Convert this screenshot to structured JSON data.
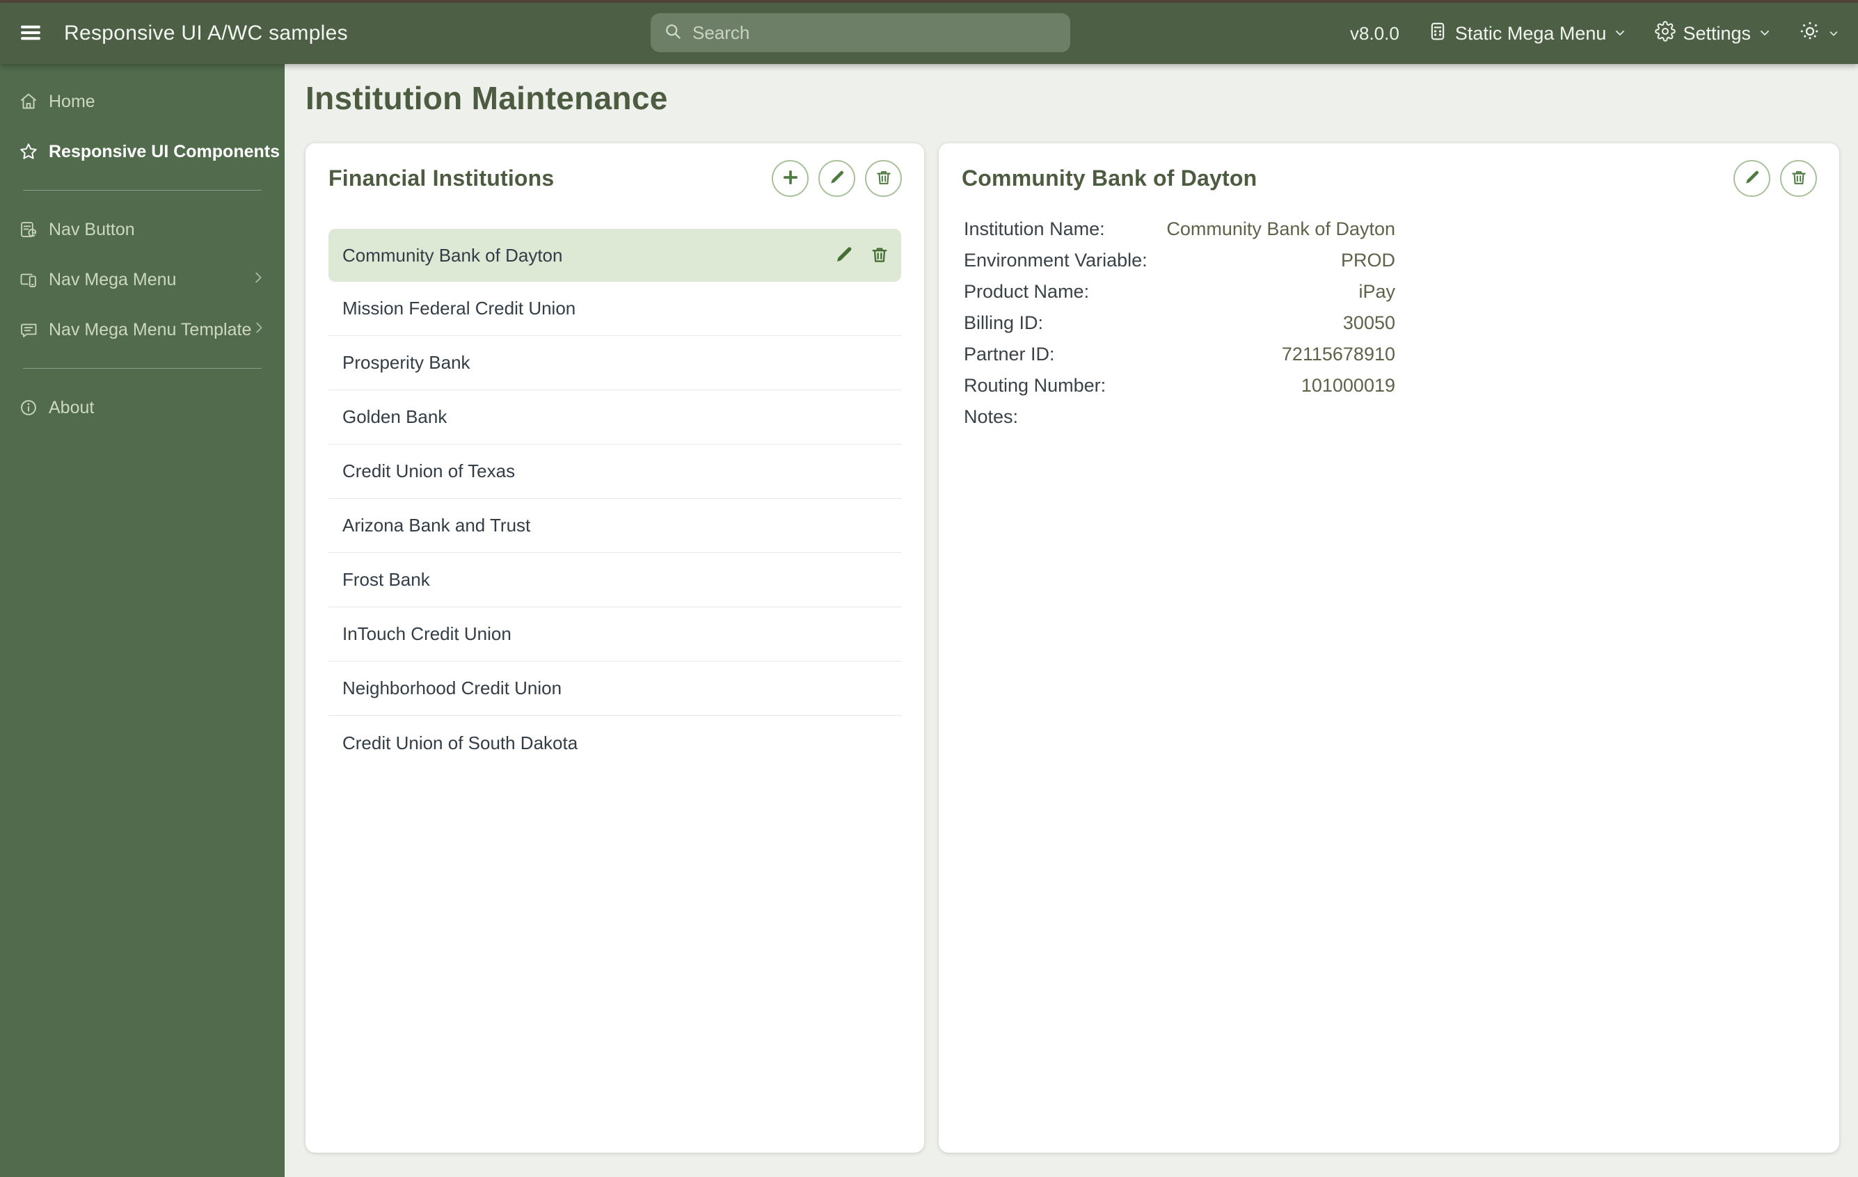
{
  "app": {
    "title": "Responsive UI A/WC samples",
    "version": "v8.0.0"
  },
  "topbar": {
    "search": {
      "placeholder": "Search"
    },
    "mega_menu": {
      "label": "Static Mega Menu"
    },
    "settings": {
      "label": "Settings"
    }
  },
  "sidebar": {
    "items": [
      {
        "label": "Home"
      },
      {
        "label": "Responsive UI Components"
      },
      {
        "label": "Nav Button"
      },
      {
        "label": "Nav Mega Menu"
      },
      {
        "label": "Nav Mega Menu Template"
      },
      {
        "label": "About"
      }
    ]
  },
  "main": {
    "page_title": "Institution Maintenance",
    "financial_institutions": {
      "title": "Financial Institutions",
      "selected_index": 0,
      "items": [
        "Community Bank of Dayton",
        "Mission Federal Credit Union",
        "Prosperity Bank",
        "Golden Bank",
        "Credit Union of Texas",
        "Arizona Bank and Trust",
        "Frost Bank",
        "InTouch Credit Union",
        "Neighborhood Credit Union",
        "Credit Union of South Dakota"
      ]
    },
    "institution_detail": {
      "title": "Community Bank of Dayton",
      "fields": [
        {
          "label": "Institution Name:",
          "value": "Community Bank of Dayton"
        },
        {
          "label": "Environment Variable:",
          "value": "PROD"
        },
        {
          "label": "Product Name:",
          "value": "iPay"
        },
        {
          "label": "Billing ID:",
          "value": "30050"
        },
        {
          "label": "Partner ID:",
          "value": "72115678910"
        },
        {
          "label": "Routing Number:",
          "value": "101000019"
        },
        {
          "label": "Notes:",
          "value": ""
        }
      ]
    }
  },
  "colors": {
    "topbar_bg": "#4d6046",
    "sidebar_bg": "#516b4c",
    "page_bg": "#eef0ec",
    "accent_green": "#4e7b41",
    "selected_row_bg": "#dde8d5",
    "olive_heading": "#4d5c40",
    "detail_value": "#5d6349",
    "top_strip": "#54443a"
  }
}
